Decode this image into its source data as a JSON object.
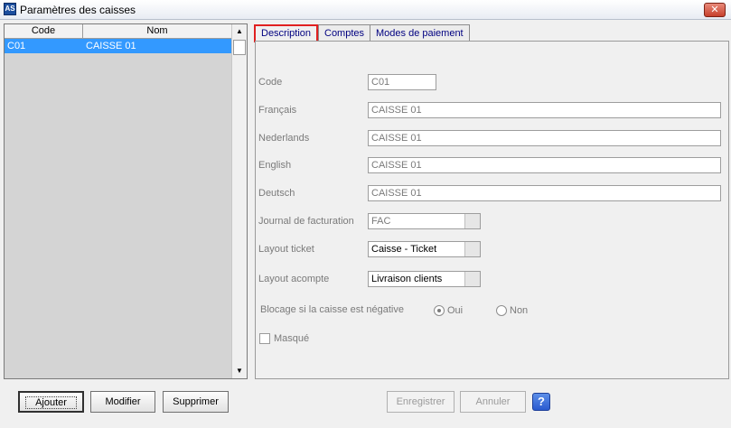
{
  "window": {
    "title": "Paramètres des caisses",
    "app_icon": "AS",
    "close_glyph": "✕"
  },
  "list": {
    "columns": [
      "Code",
      "Nom"
    ],
    "rows": [
      {
        "code": "C01",
        "nom": "CAISSE 01",
        "selected": true
      }
    ]
  },
  "tabs": [
    {
      "label": "Description",
      "active": true
    },
    {
      "label": "Comptes",
      "active": false
    },
    {
      "label": "Modes de paiement",
      "active": false
    }
  ],
  "form": {
    "code": {
      "label": "Code",
      "value": "C01"
    },
    "francais": {
      "label": "Français",
      "value": "CAISSE 01"
    },
    "nederlands": {
      "label": "Nederlands",
      "value": "CAISSE 01"
    },
    "english": {
      "label": "English",
      "value": "CAISSE 01"
    },
    "deutsch": {
      "label": "Deutsch",
      "value": "CAISSE 01"
    },
    "journal": {
      "label": "Journal de facturation",
      "value": "FAC"
    },
    "layout_ticket": {
      "label": "Layout ticket",
      "value": "Caisse - Ticket"
    },
    "layout_acompte": {
      "label": "Layout acompte",
      "value": "Livraison clients"
    },
    "blocage": {
      "label": "Blocage si la caisse est négative",
      "oui": "Oui",
      "non": "Non",
      "selected": "Oui"
    },
    "masque": {
      "label": "Masqué",
      "checked": false
    }
  },
  "buttons": {
    "ajouter": "Ajouter",
    "modifier": "Modifier",
    "supprimer": "Supprimer",
    "enregistrer": "Enregistrer",
    "annuler": "Annuler",
    "help": "?"
  },
  "colors": {
    "selection": "#3399ff",
    "active_tab_border": "#e02020",
    "help": "#2a5ad0"
  }
}
